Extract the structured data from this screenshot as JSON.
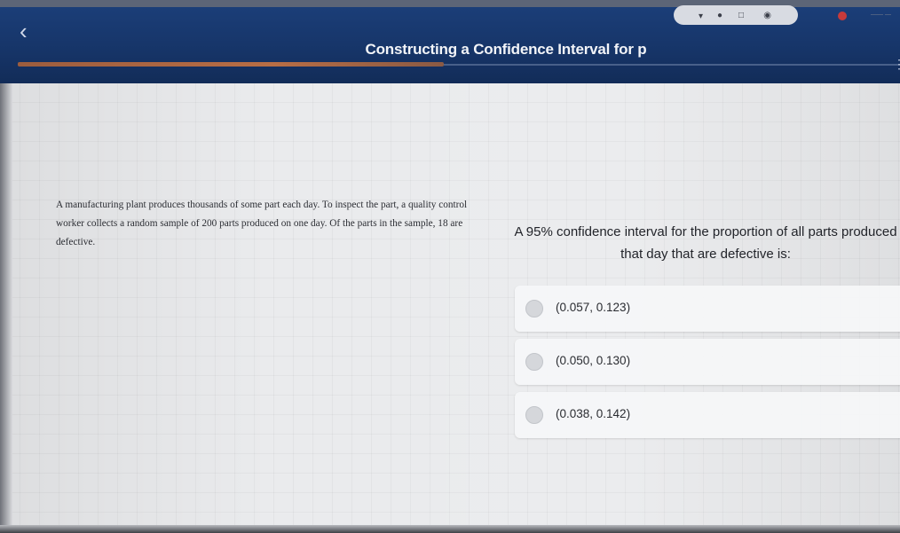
{
  "header": {
    "title": "Constructing a Confidence Interval for p"
  },
  "problem": {
    "text": "A manufacturing plant produces thousands of some part each day. To inspect the part, a quality control worker collects a random sample of 200 parts produced on one day. Of the parts in the sample, 18 are defective."
  },
  "question": {
    "text": "A 95% confidence interval for the proportion of all parts produced that day that are defective is:"
  },
  "options": [
    {
      "label": "(0.057, 0.123)"
    },
    {
      "label": "(0.050, 0.130)"
    },
    {
      "label": "(0.038, 0.142)"
    }
  ],
  "icons": {
    "back": "chevron-left-icon",
    "menu": "more-vertical-icon",
    "radio": "radio-unselected"
  },
  "colors": {
    "header": "#163467",
    "accent": "#b86e45",
    "background": "#eaebed"
  }
}
